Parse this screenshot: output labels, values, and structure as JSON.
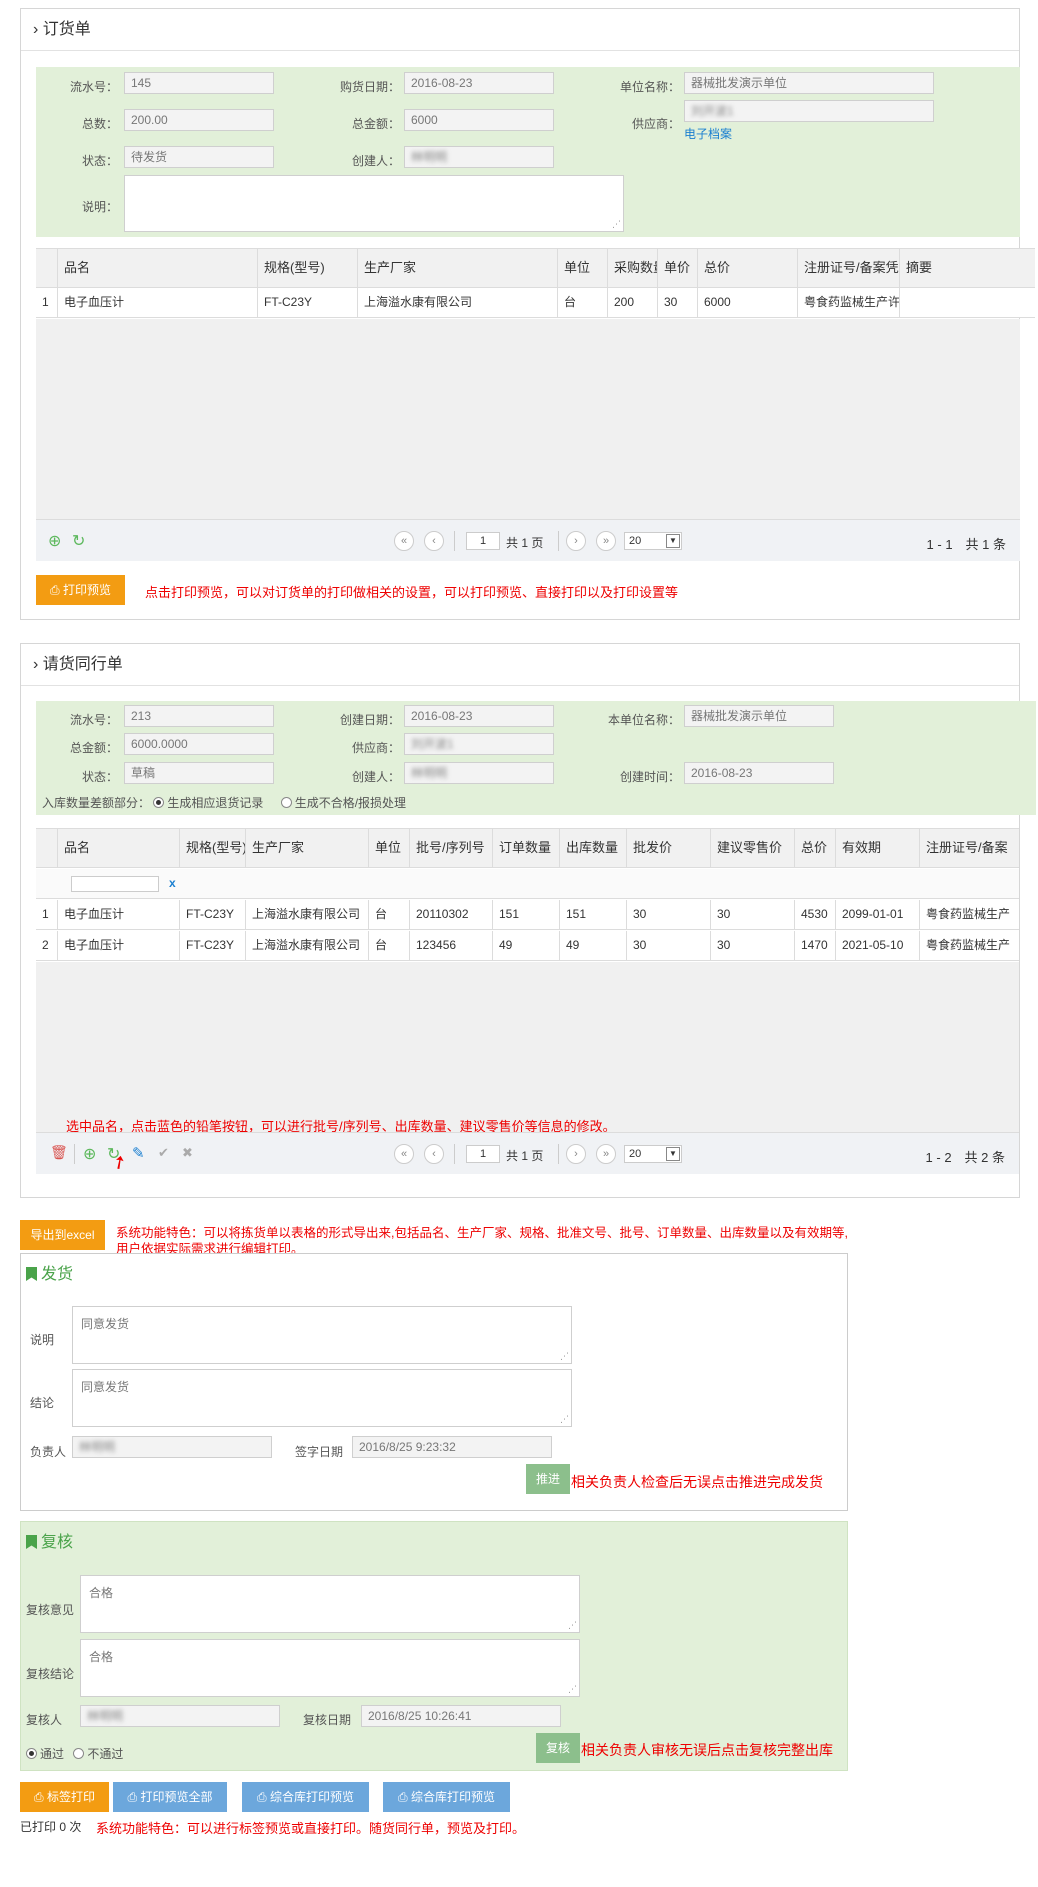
{
  "order": {
    "title": "订货单",
    "serial_label": "流水号：",
    "serial": "145",
    "buy_date_label": "购货日期：",
    "buy_date": "2016-08-23",
    "unit_label": "单位名称：",
    "unit": "器械批发演示单位",
    "qty_label": "总数：",
    "qty": "200.00",
    "amount_label": "总金额：",
    "amount": "6000",
    "supplier_label": "供应商：",
    "supplier": "刘开波1",
    "archive_link": "电子档案",
    "status_label": "状态：",
    "status": "待发货",
    "creator_label": "创建人：",
    "creator": "林明明",
    "note_label": "说明：",
    "columns": [
      "品名",
      "规格(型号)",
      "生产厂家",
      "单位",
      "采购数量",
      "单价",
      "总价",
      "注册证号/备案凭证",
      "摘要"
    ],
    "rows": [
      {
        "no": "1",
        "name": "电子血压计",
        "spec": "FT-C23Y",
        "maker": "上海溢水康有限公司",
        "unit": "台",
        "qty": "200",
        "price": "30",
        "total": "6000",
        "reg": "粤食药监械生产许",
        "memo": ""
      }
    ],
    "pager": {
      "page": "1",
      "total_pages": "共 1 页",
      "size": "20",
      "info": "1 - 1　共 1 条"
    },
    "print_btn": "打印预览",
    "print_note": "点击打印预览，可以对订货单的打印做相关的设置，可以打印预览、直接打印以及打印设置等"
  },
  "picking": {
    "title": "请货同行单",
    "serial_label": "流水号：",
    "serial": "213",
    "create_date_label": "创建日期：",
    "create_date": "2016-08-23",
    "unit_label": "本单位名称：",
    "unit": "器械批发演示单位",
    "amount_label": "总金额：",
    "amount": "6000.0000",
    "supplier_label": "供应商：",
    "supplier": "刘开波1",
    "status_label": "状态：",
    "status": "草稿",
    "creator_label": "创建人：",
    "creator": "林明明",
    "create_time_label": "创建时间：",
    "create_time": "2016-08-23",
    "diff_label": "入库数量差额部分：",
    "diff_opt1": "生成相应退货记录",
    "diff_opt2": "生成不合格/报损处理",
    "columns": [
      "品名",
      "规格(型号)",
      "生产厂家",
      "单位",
      "批号/序列号",
      "订单数量",
      "出库数量",
      "批发价",
      "建议零售价",
      "总价",
      "有效期",
      "注册证号/备案"
    ],
    "filter_clear": "x",
    "rows": [
      {
        "no": "1",
        "name": "电子血压计",
        "spec": "FT-C23Y",
        "maker": "上海溢水康有限公司",
        "unit": "台",
        "batch": "20110302",
        "order_qty": "151",
        "out_qty": "151",
        "price": "30",
        "retail": "30",
        "total": "4530",
        "expiry": "2099-01-01",
        "reg": "粤食药监械生产"
      },
      {
        "no": "2",
        "name": "电子血压计",
        "spec": "FT-C23Y",
        "maker": "上海溢水康有限公司",
        "unit": "台",
        "batch": "123456",
        "order_qty": "49",
        "out_qty": "49",
        "price": "30",
        "retail": "30",
        "total": "1470",
        "expiry": "2021-05-10",
        "reg": "粤食药监械生产"
      }
    ],
    "edit_note": "选中品名，点击蓝色的铅笔按钮，可以进行批号/序列号、出库数量、建议零售价等信息的修改。",
    "pager": {
      "page": "1",
      "total_pages": "共 1 页",
      "size": "20",
      "info": "1 - 2　共 2 条"
    }
  },
  "export": {
    "btn": "导出到excel",
    "note1": "系统功能特色：可以将拣货单以表格的形式导出来,包括品名、生产厂家、规格、批准文号、批号、订单数量、出库数量以及有效期等,",
    "note2": "用户依据实际需求进行编辑打印。"
  },
  "ship": {
    "title": "发货",
    "desc_label": "说明",
    "desc": "同意发货",
    "concl_label": "结论",
    "concl": "同意发货",
    "person_label": "负责人",
    "person": "林明明",
    "sign_label": "签字日期",
    "sign_date": "2016/8/25 9:23:32",
    "push_btn": "推进",
    "push_note": "相关负责人检查后无误点击推进完成发货"
  },
  "review": {
    "title": "复核",
    "opinion_label": "复核意见",
    "opinion": "合格",
    "concl_label": "复核结论",
    "concl": "合格",
    "person_label": "复核人",
    "person": "林明明",
    "date_label": "复核日期",
    "date": "2016/8/25 10:26:41",
    "pass": "通过",
    "fail": "不通过",
    "btn": "复核",
    "note": "相关负责人审核无误后点击复核完整出库"
  },
  "footer": {
    "label_print": "标签打印",
    "print_all": "打印预览全部",
    "store_print1": "综合库打印预览",
    "store_print2": "综合库打印预览",
    "printed": "已打印 0 次",
    "note": "系统功能特色：可以进行标签预览或直接打印。随货同行单，预览及打印。"
  },
  "colors": {
    "green_panel": "#e2f0d9",
    "orange": "#f39c12",
    "blue": "#6ca7dc",
    "note_red": "#e00000"
  }
}
